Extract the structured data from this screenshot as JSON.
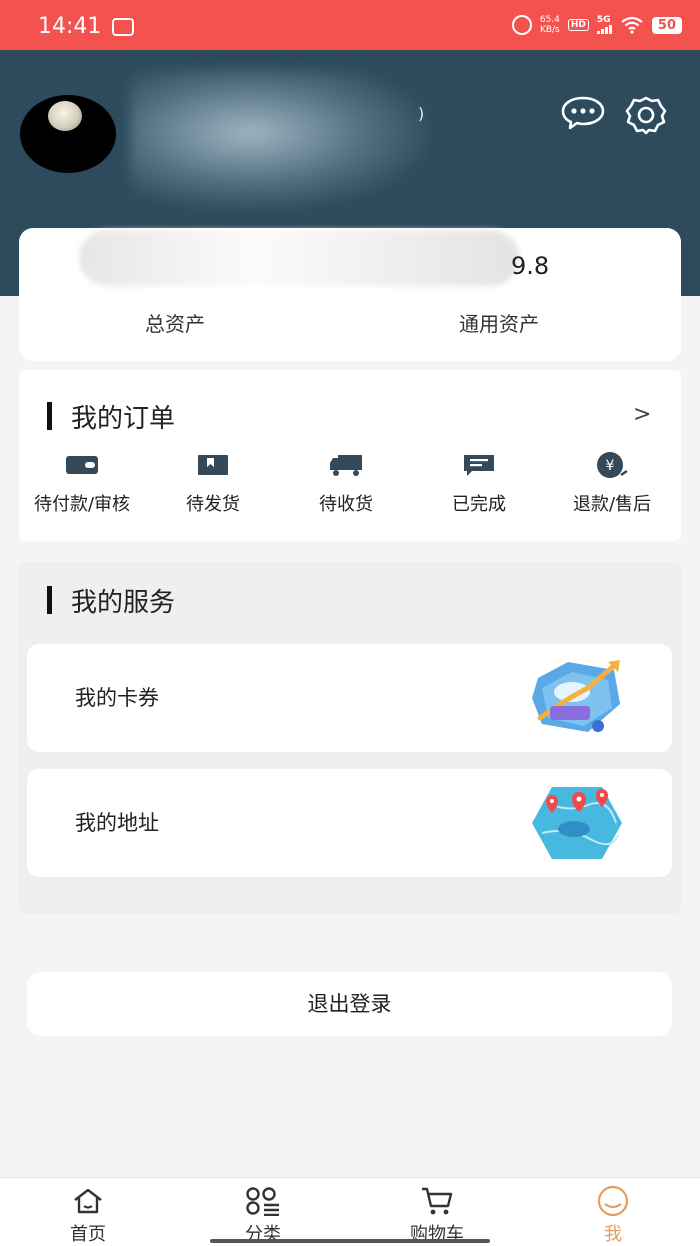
{
  "status_bar": {
    "time": "14:41",
    "net_speed_value": "65.4",
    "net_speed_unit": "KB/s",
    "hd_label": "HD",
    "network": "5G",
    "battery": "50"
  },
  "header": {
    "name_suffix": ")",
    "icons": [
      "message-icon",
      "settings-icon"
    ]
  },
  "assets": {
    "value_visible": "9.8",
    "total_label": "总资产",
    "general_label": "通用资产"
  },
  "orders": {
    "title": "我的订单",
    "more_chevron": ">",
    "items": [
      {
        "label": "待付款/审核",
        "icon": "wallet-icon"
      },
      {
        "label": "待发货",
        "icon": "box-icon"
      },
      {
        "label": "待收货",
        "icon": "truck-icon"
      },
      {
        "label": "已完成",
        "icon": "message-lines-icon"
      },
      {
        "label": "退款/售后",
        "icon": "yuan-coin-icon"
      }
    ]
  },
  "services": {
    "title": "我的服务",
    "items": [
      {
        "label": "我的卡券",
        "icon": "growth-chart-illustration"
      },
      {
        "label": "我的地址",
        "icon": "map-pins-illustration"
      }
    ]
  },
  "logout_label": "退出登录",
  "nav": {
    "items": [
      {
        "label": "首页",
        "icon": "home-icon"
      },
      {
        "label": "分类",
        "icon": "category-icon"
      },
      {
        "label": "购物车",
        "icon": "cart-icon"
      },
      {
        "label": "我",
        "icon": "profile-icon"
      }
    ],
    "active_color": "#e0a060"
  },
  "colors": {
    "status_bar": "#f4524f",
    "header": "#2d4b5d",
    "accent": "#e0a060"
  }
}
